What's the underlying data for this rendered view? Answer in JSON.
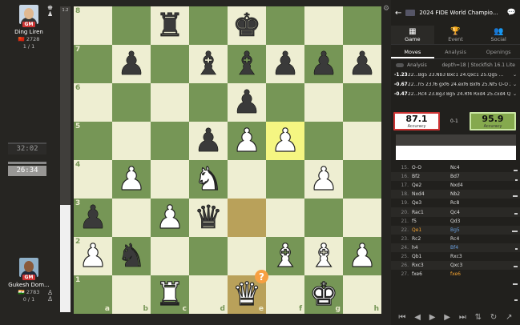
{
  "black_player": {
    "name": "Ding Liren",
    "title": "GM",
    "flag": "🇨🇳",
    "rating": "2728",
    "score": "1 / 1",
    "clock": "32:02"
  },
  "white_player": {
    "name": "Gukesh Dom...",
    "title": "GM",
    "flag": "🇮🇳",
    "rating": "2783",
    "score": "0 / 1",
    "clock": "26:34"
  },
  "eval_bar": {
    "label": "1.2",
    "white_fraction": 0.35
  },
  "board": {
    "ranks": [
      "8",
      "7",
      "6",
      "5",
      "4",
      "3",
      "2",
      "1"
    ],
    "files": [
      "a",
      "b",
      "c",
      "d",
      "e",
      "f",
      "g",
      "h"
    ],
    "position": [
      [
        "",
        "",
        "r",
        "",
        "k",
        "",
        "",
        ""
      ],
      [
        "",
        "p",
        "",
        "b",
        "b",
        "p",
        "p",
        "p"
      ],
      [
        "",
        "",
        "",
        "",
        "p",
        "",
        "",
        ""
      ],
      [
        "",
        "",
        "",
        "p",
        "P",
        "P",
        "",
        ""
      ],
      [
        "",
        "P",
        "",
        "N",
        "",
        "",
        "P",
        ""
      ],
      [
        "p",
        "",
        "P",
        "q",
        "",
        "",
        "",
        ""
      ],
      [
        "P",
        "n",
        "",
        "",
        "",
        "B",
        "B",
        "P"
      ],
      [
        "",
        "",
        "R",
        "",
        "Q",
        "",
        "K",
        ""
      ]
    ],
    "highlight_yellow": "f5",
    "highlight_dark": [
      "e3",
      "e1"
    ],
    "annotation_square": "e1",
    "annotation_symbol": "?"
  },
  "panel": {
    "title": "2024 FIDE World Champio...",
    "tabs": [
      {
        "label": "Game",
        "icon": "▦"
      },
      {
        "label": "Event",
        "icon": "🏆"
      },
      {
        "label": "Social",
        "icon": "👥"
      }
    ],
    "subtabs": [
      "Moves",
      "Analysis",
      "Openings"
    ],
    "analysis_label": "Analysis",
    "engine": "depth=18 | Stockfish 16.1 Lite",
    "lines": [
      {
        "eval": "-1.23",
        "moves": "22...Bg5 23.Nb3 Bxc1 24.Qxc1 25.Qg5 ..."
      },
      {
        "eval": "-0.67",
        "moves": "22...h5 23.f6 gxf6 24.exf6 Bxf6 25.Nf5 O-O 2..."
      },
      {
        "eval": "-0.47",
        "moves": "22...Rc4 23.Bg3 Bg5 24.Rf4 Rxd4 25.cxd4 Qx..."
      }
    ],
    "accuracy_white": {
      "value": "87.1",
      "label": "Accuracy"
    },
    "accuracy_black": {
      "value": "95.9",
      "label": "Accuracy"
    },
    "result": "0-1",
    "moves": [
      {
        "no": "15.",
        "w": "O-O",
        "b": "Nc4"
      },
      {
        "no": "16.",
        "w": "Bf2",
        "b": "Bd7"
      },
      {
        "no": "17.",
        "w": "Qe2",
        "b": "Nxd4"
      },
      {
        "no": "18.",
        "w": "Nxd4",
        "b": "Nb2"
      },
      {
        "no": "19.",
        "w": "Qe3",
        "b": "Rc8"
      },
      {
        "no": "20.",
        "w": "Rac1",
        "b": "Qc4"
      },
      {
        "no": "21.",
        "w": "f5",
        "b": "Qd3"
      },
      {
        "no": "22.",
        "w": "Qe1",
        "b": "Bg5"
      },
      {
        "no": "23.",
        "w": "Rc2",
        "b": "Rc4"
      },
      {
        "no": "24.",
        "w": "h4",
        "b": "Bf4"
      },
      {
        "no": "25.",
        "w": "Qb1",
        "b": "Rxc3"
      },
      {
        "no": "26.",
        "w": "Rxc3",
        "b": "Qxc3"
      },
      {
        "no": "27.",
        "w": "fxe6",
        "b": "fxe6"
      }
    ]
  }
}
